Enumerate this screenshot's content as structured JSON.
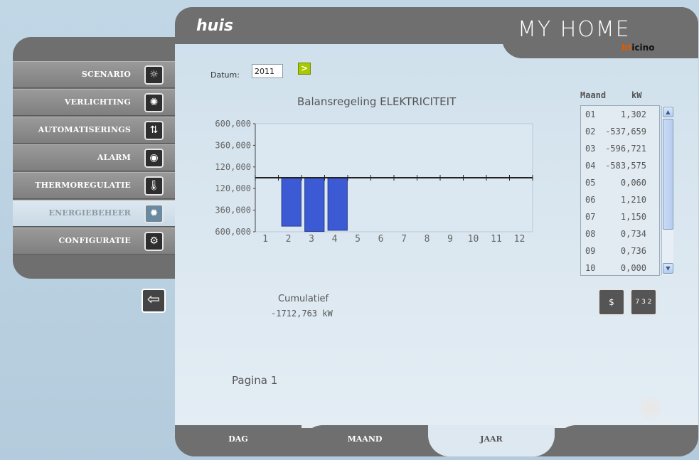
{
  "header": {
    "title": "huis",
    "logo": "MY HOME",
    "brand_prefix": "bt",
    "brand_suffix": "icino"
  },
  "sidebar": {
    "items": [
      {
        "label": "SCENARIO",
        "icon": "scenario-icon",
        "active": false
      },
      {
        "label": "VERLICHTING",
        "icon": "lightbulb-icon",
        "active": false
      },
      {
        "label": "AUTOMATISERINGS",
        "icon": "shutter-icon",
        "active": false
      },
      {
        "label": "ALARM",
        "icon": "alarm-icon",
        "active": false
      },
      {
        "label": "THERMOREGULATIE",
        "icon": "thermometer-icon",
        "active": false
      },
      {
        "label": "ENERGIEBEHEER",
        "icon": "energy-icon",
        "active": true
      },
      {
        "label": "CONFIGURATIE",
        "icon": "gear-icon",
        "active": false
      }
    ],
    "back_icon": "back-arrow-icon"
  },
  "filter": {
    "date_label": "Datum:",
    "date_value": "2011",
    "go_label": ">"
  },
  "chart_data": {
    "type": "bar",
    "title": "Balansregeling ELEKTRICITEIT",
    "categories": [
      "1",
      "2",
      "3",
      "4",
      "5",
      "6",
      "7",
      "8",
      "9",
      "10",
      "11",
      "12"
    ],
    "values": [
      1.302,
      -537.659,
      -596.721,
      -583.575,
      0.06,
      1.21,
      1.15,
      0.734,
      0.736,
      0.0,
      0,
      0
    ],
    "ytick_labels": [
      "600,000",
      "360,000",
      "120,000",
      "120,000",
      "360,000",
      "600,000"
    ],
    "ylim": [
      -600,
      600
    ],
    "grid": false,
    "bar_color": "#3c5ad4"
  },
  "summary": {
    "label": "Cumulatief",
    "value": "-1712,763 kW"
  },
  "pagination": {
    "label": "Pagina 1"
  },
  "month_table": {
    "header_month": "Maand",
    "header_value": "kW",
    "rows": [
      {
        "month": "01",
        "value": "1,302"
      },
      {
        "month": "02",
        "value": "-537,659"
      },
      {
        "month": "03",
        "value": "-596,721"
      },
      {
        "month": "04",
        "value": "-583,575"
      },
      {
        "month": "05",
        "value": "0,060"
      },
      {
        "month": "06",
        "value": "1,210"
      },
      {
        "month": "07",
        "value": "1,150"
      },
      {
        "month": "08",
        "value": "0,734"
      },
      {
        "month": "09",
        "value": "0,736"
      },
      {
        "month": "10",
        "value": "0,000"
      }
    ]
  },
  "tools": {
    "cost_label": "$",
    "sort_label": "7 3 2"
  },
  "tabs": [
    {
      "label": "DAG",
      "active": false
    },
    {
      "label": "MAAND",
      "active": false
    },
    {
      "label": "JAAR",
      "active": true
    }
  ]
}
